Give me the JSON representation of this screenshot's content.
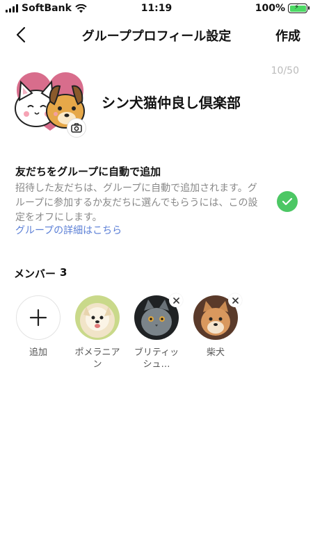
{
  "status_bar": {
    "carrier": "SoftBank",
    "time": "11:19",
    "battery": "100%",
    "battery_color": "#4cd964"
  },
  "header": {
    "back_icon": "chevron-left-icon",
    "title": "グループプロフィール設定",
    "create_label": "作成"
  },
  "profile": {
    "char_count": "10/50",
    "group_name": "シン犬猫仲良し倶楽部",
    "camera_icon": "camera-icon"
  },
  "auto_add": {
    "title": "友だちをグループに自動で追加",
    "description": "招待した友だちは、グループに自動で追加されます。グループに参加するか友だちに選んでもらうには、この設定をオフにします。",
    "link": "グループの詳細はこちら",
    "checked": true,
    "check_color": "#4cc764"
  },
  "members": {
    "heading": "メンバー",
    "count": "3",
    "add_label": "追加",
    "items": [
      {
        "label": "ポメラニアン",
        "removable": false
      },
      {
        "label": "ブリティッシュ…",
        "removable": true
      },
      {
        "label": "柴犬",
        "removable": true
      }
    ]
  },
  "colors": {
    "link": "#5b7fd6",
    "muted_text": "#888888"
  }
}
